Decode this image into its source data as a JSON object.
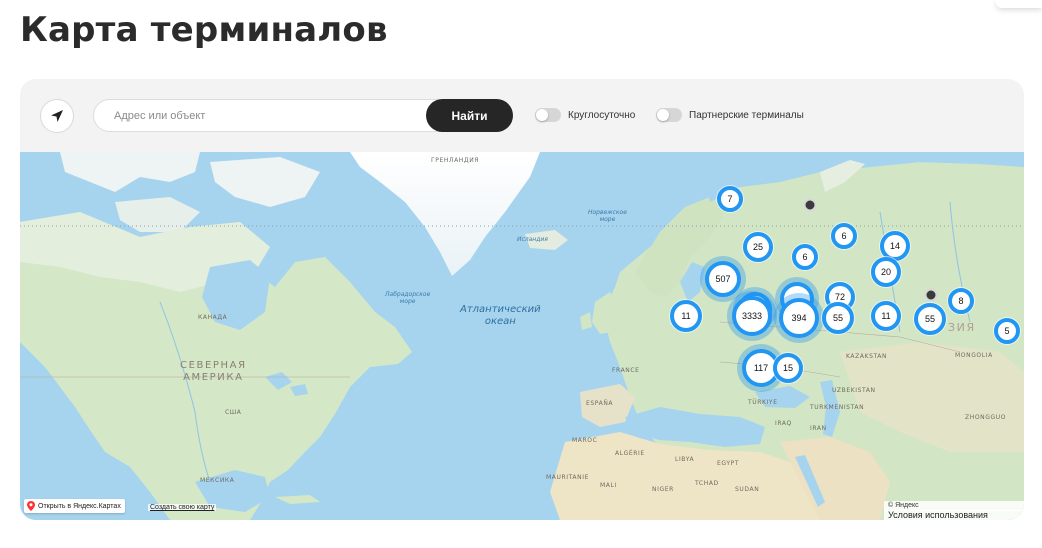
{
  "page": {
    "title": "Карта терминалов"
  },
  "toolbar": {
    "search_placeholder": "Адрес или объект",
    "search_button": "Найти",
    "toggles": [
      {
        "label": "Круглосуточно",
        "on": false
      },
      {
        "label": "Партнерские терминалы",
        "on": false
      }
    ]
  },
  "map": {
    "clusters": [
      "7",
      "25",
      "6",
      "6",
      "14",
      "20",
      "507",
      "72",
      "11",
      "3333",
      "394",
      "55",
      "11",
      "55",
      "8",
      "5",
      "117",
      "15"
    ],
    "accent_color": "#2196f3",
    "labels": {
      "greenland": "ГРЕНЛАНДИЯ",
      "iceland": "Исландия",
      "norwegian_sea_1": "Норвежское",
      "norwegian_sea_2": "море",
      "labrador_sea_1": "Лабрадорское",
      "labrador_sea_2": "море",
      "atlantic_1": "Атлантический",
      "atlantic_2": "океан",
      "north_america_1": "СЕВЕРНАЯ",
      "north_america_2": "АМЕРИКА",
      "canada": "КАНАДА",
      "usa": "США",
      "mexico": "МЕКСИКА",
      "kazakhstan": "KAZAKSTAN",
      "uzbekistan": "UZBEKISTAN",
      "turkmenistan": "TURKMENISTAN",
      "iran": "IRAN",
      "iraq": "IRAQ",
      "turkey": "TÜRKIYE",
      "spain": "ESPAÑA",
      "france": "FRANCE",
      "algeria": "ALGÉRIE",
      "libya": "LIBYA",
      "egypt": "EGYPT",
      "mali": "MALI",
      "niger": "NIGER",
      "sudan": "SUDAN",
      "chad": "TCHAD",
      "mauritania": "MAURITANIE",
      "morocco": "MAROC",
      "mongolia": "MONGOLIA",
      "china": "ZHONGGUO",
      "asia": "ЗИЯ"
    },
    "open_in_yandex": "Открыть в Яндекс.Картах",
    "create_map": "Создать свою карту",
    "copyright": "© Яндекс",
    "terms": "Условия использования"
  }
}
